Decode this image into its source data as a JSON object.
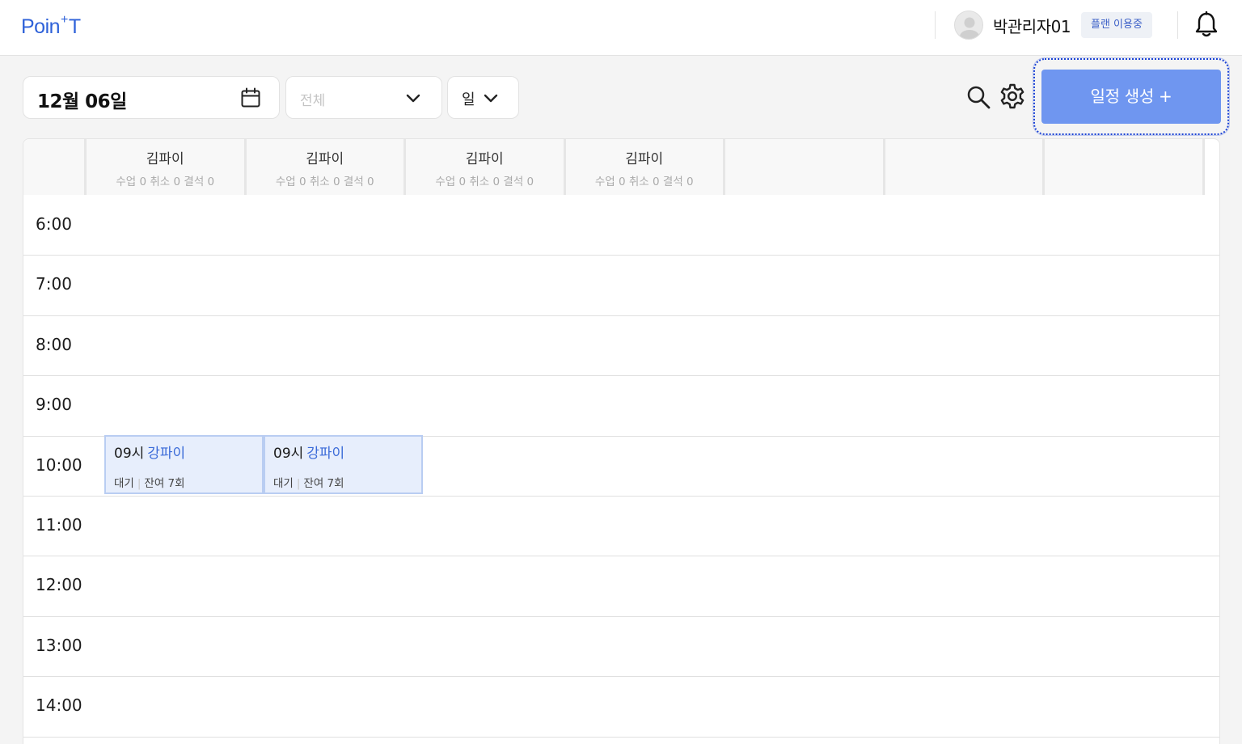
{
  "header": {
    "logo_left": "Poin",
    "logo_plus": "+",
    "logo_right": "T",
    "user_name": "박관리자01",
    "plan_badge": "플랜 이용중"
  },
  "toolbar": {
    "date": "12월 06일",
    "filter_placeholder": "전체",
    "view_mode": "일",
    "create_button": "일정 생성 +"
  },
  "columns": [
    {
      "name": "김파이",
      "stats": "수업 0 취소 0 결석 0"
    },
    {
      "name": "김파이",
      "stats": "수업 0 취소 0 결석 0"
    },
    {
      "name": "김파이",
      "stats": "수업 0 취소 0 결석 0"
    },
    {
      "name": "김파이",
      "stats": "수업 0 취소 0 결석 0"
    },
    {
      "name": "",
      "stats": ""
    },
    {
      "name": "",
      "stats": ""
    },
    {
      "name": "",
      "stats": ""
    }
  ],
  "times": [
    "6:00",
    "7:00",
    "8:00",
    "9:00",
    "10:00",
    "11:00",
    "12:00",
    "13:00",
    "14:00"
  ],
  "events": [
    {
      "time": "09시",
      "teacher": "강파이",
      "status": "대기",
      "remaining": "잔여 7회"
    },
    {
      "time": "09시",
      "teacher": "강파이",
      "status": "대기",
      "remaining": "잔여 7회"
    }
  ],
  "colors": {
    "brand": "#2f62d9",
    "create_button": "#6f96f0",
    "event_bg": "#e7eefc",
    "event_border": "#b9cdf2",
    "focus_ring": "#1d44d6"
  }
}
